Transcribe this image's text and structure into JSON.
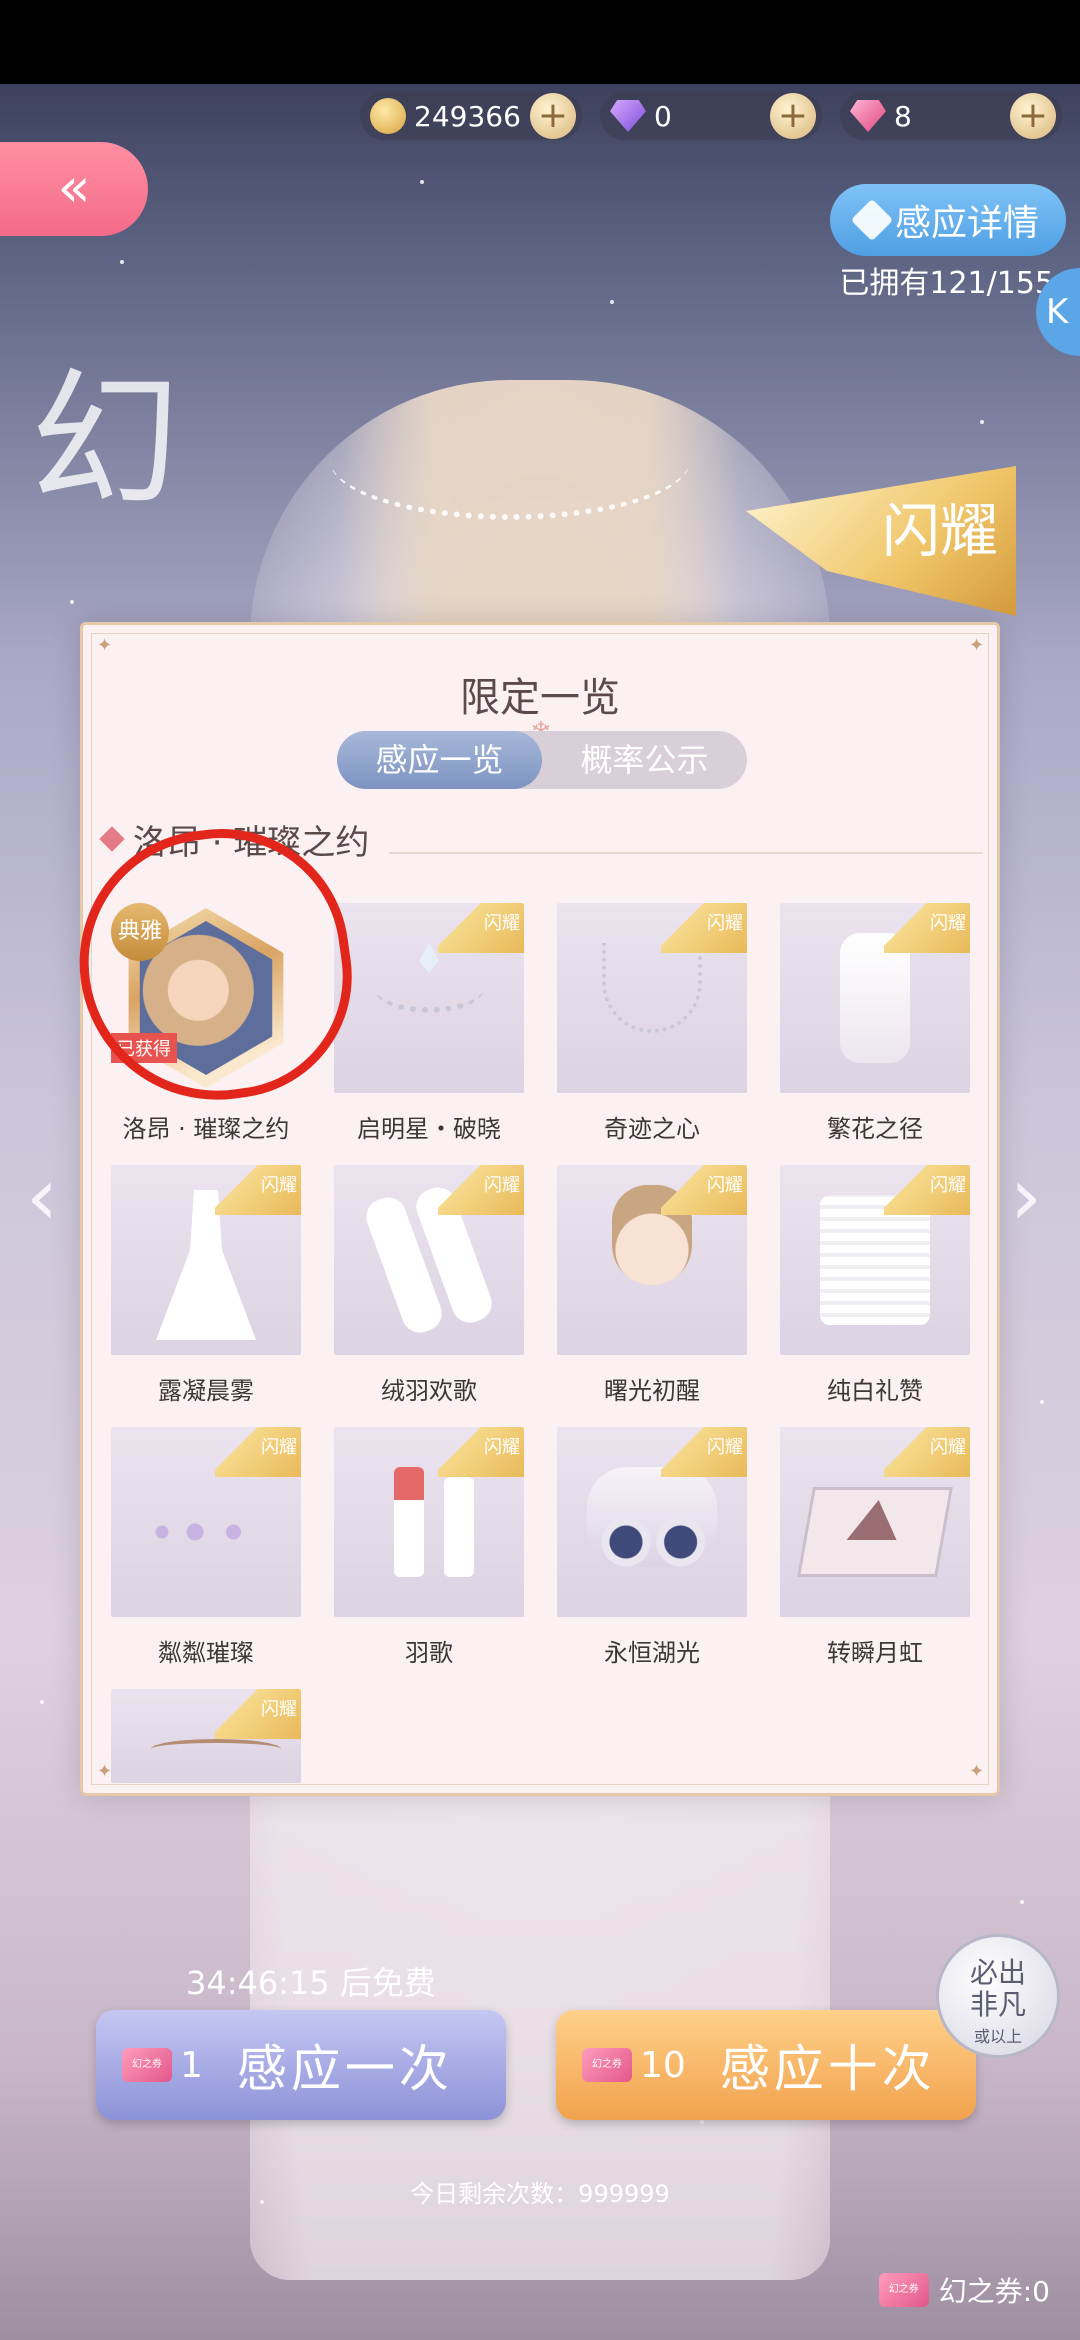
{
  "topbar": {
    "coins": "249366",
    "purple_diamonds": "0",
    "pink_diamonds": "8",
    "plus_symbol": "+"
  },
  "nav": {
    "back_symbol": "«",
    "detail_button": "感应详情",
    "owned_text": "已拥有121/155",
    "side_tab": "K"
  },
  "banner": {
    "flag_text": "闪耀",
    "side_script": "幻"
  },
  "panel": {
    "title": "限定一览",
    "tabs": [
      {
        "label": "感应一览",
        "active": true
      },
      {
        "label": "概率公示",
        "active": false
      }
    ],
    "section_title": "洛昂 · 璀璨之约",
    "ribbon_text": "闪耀",
    "featured": {
      "rarity": "典雅",
      "status": "已获得"
    },
    "items": [
      {
        "label": "洛昂 · 璀璨之约",
        "art": "portrait"
      },
      {
        "label": "启明星・破晓",
        "art": "tiara"
      },
      {
        "label": "奇迹之心",
        "art": "necklace"
      },
      {
        "label": "繁花之径",
        "art": "shoes"
      },
      {
        "label": "露凝晨雾",
        "art": "dress"
      },
      {
        "label": "绒羽欢歌",
        "art": "gloves"
      },
      {
        "label": "曙光初醒",
        "art": "hairstyle"
      },
      {
        "label": "纯白礼赞",
        "art": "socks"
      },
      {
        "label": "粼粼璀璨",
        "art": "gems"
      },
      {
        "label": "羽歌",
        "art": "lipstick"
      },
      {
        "label": "永恒湖光",
        "art": "compact"
      },
      {
        "label": "转瞬月虹",
        "art": "palette"
      },
      {
        "label": "",
        "art": "brush"
      }
    ]
  },
  "bottom": {
    "timer": "34:46:15 后免费",
    "single": {
      "count": "1",
      "label": "感应一次"
    },
    "ten": {
      "count": "10",
      "label": "感应十次"
    },
    "ticket_icon_text": "幻之券",
    "guarantee": {
      "line1": "必出",
      "line2": "非凡",
      "line3": "或以上"
    },
    "remaining": "今日剩余次数：999999",
    "ticket_count": "幻之券:0"
  },
  "colors": {
    "accent_pink": "#f46b89",
    "accent_blue": "#4f9fe3",
    "gold": "#e8b755",
    "highlight_red": "#e3261b"
  }
}
